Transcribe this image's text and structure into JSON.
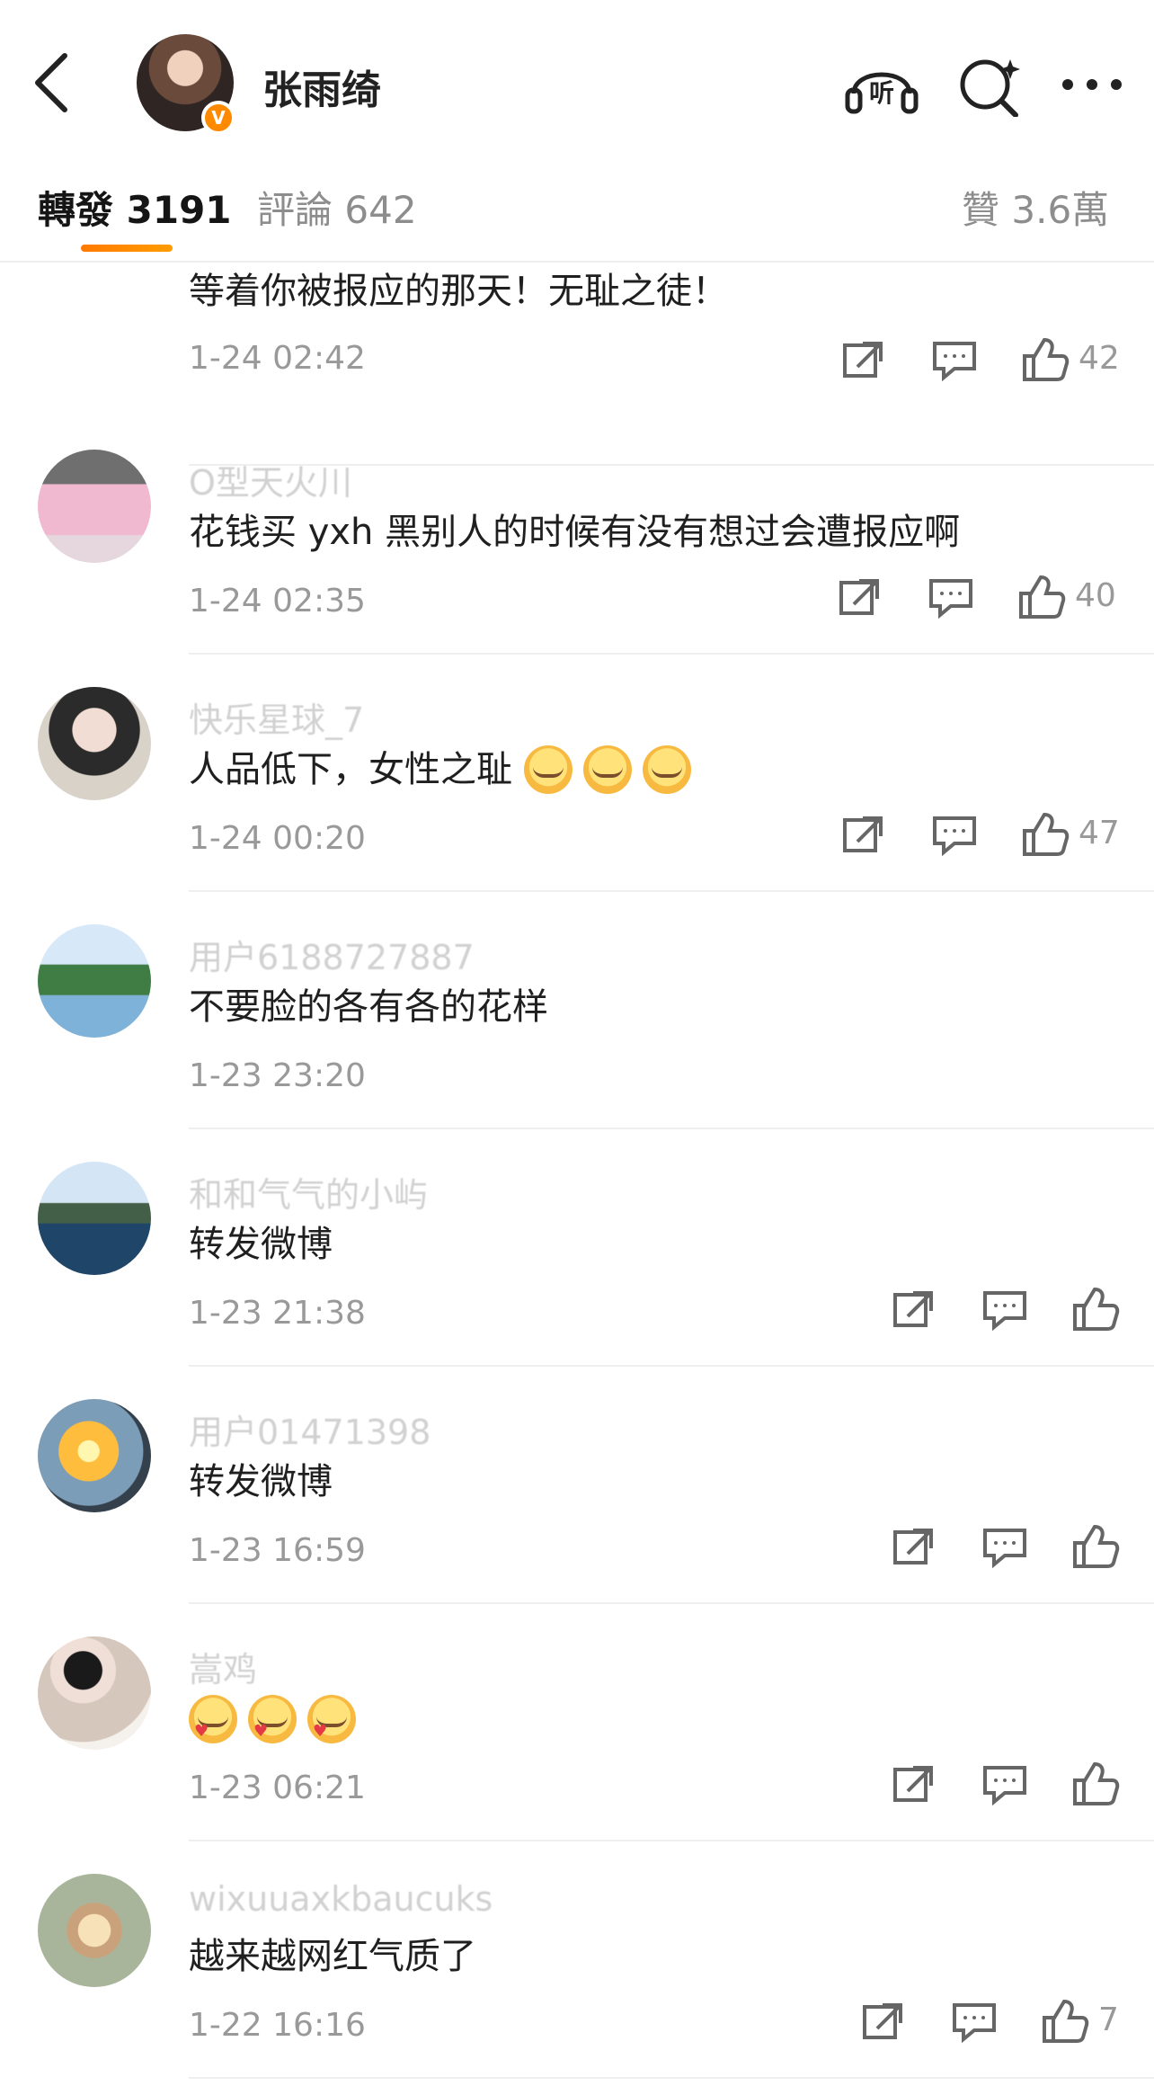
{
  "header": {
    "user_name": "张雨绮",
    "verified_badge": "V",
    "icons": [
      "back-icon",
      "listen-icon",
      "search-ai-icon",
      "more-icon"
    ],
    "listen_label": "听"
  },
  "tabs": {
    "repost": {
      "label": "轉發",
      "count": "3191"
    },
    "comment": {
      "label": "評論",
      "count": "642"
    },
    "like": {
      "label": "贊",
      "count": "3.6萬"
    }
  },
  "comments": [
    {
      "avatar": "red-shirt-avatar",
      "nick": "",
      "text": "等着你被报应的那天！无耻之徒！",
      "time": "1-24 02:42",
      "likes": "42",
      "layout": "wide"
    },
    {
      "avatar": "cartoon-avatar",
      "nick": "O型天火川",
      "text": "花钱买 yxh 黑别人的时候有没有想过会遭报应啊",
      "time": "1-24 02:35",
      "likes": "40",
      "layout": "wide"
    },
    {
      "avatar": "man-portrait-avatar",
      "nick": "快乐星球_7",
      "text": "人品低下，女性之耻",
      "time": "1-24 00:20",
      "likes": "47",
      "layout": "wide"
    },
    {
      "avatar": "lake-tree-avatar",
      "nick": "用户6188727887",
      "text": "不要脸的各有各的花样",
      "time": "1-23 23:20",
      "likes": "",
      "layout": "none"
    },
    {
      "avatar": "sea-mountain-avatar",
      "nick": "和和气气的小屿",
      "text": "转发微博",
      "time": "1-23 21:38",
      "likes": "",
      "layout": "compact"
    },
    {
      "avatar": "sunset-avatar",
      "nick": "用户01471398",
      "text": "转发微博",
      "time": "1-23 16:59",
      "likes": "",
      "layout": "compact"
    },
    {
      "avatar": "woman-food-avatar",
      "nick": "嵩鸡",
      "text": "",
      "time": "1-23 06:21",
      "likes": "",
      "layout": "compact"
    },
    {
      "avatar": "dessert-avatar",
      "nick": "wixuuaxkbaucuks",
      "text": "越来越网红气质了",
      "time": "1-22 16:16",
      "likes": "7",
      "layout": "seven"
    }
  ],
  "colors": {
    "accent": "#ff8a00",
    "text": "#1f1f1f",
    "muted": "#999999",
    "divider": "#efefef"
  }
}
